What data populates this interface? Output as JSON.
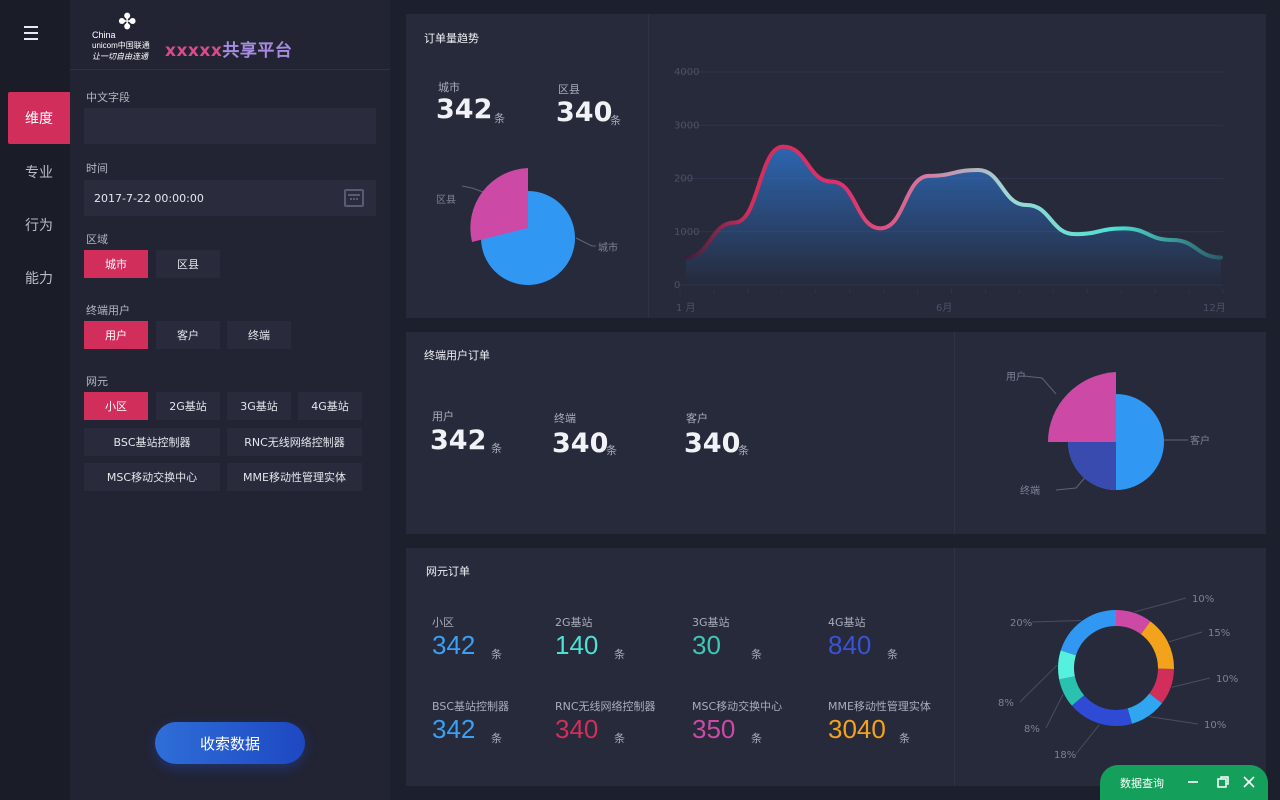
{
  "nav": {
    "items": [
      {
        "label": "维度",
        "active": true
      },
      {
        "label": "专业",
        "active": false
      },
      {
        "label": "行为",
        "active": false
      },
      {
        "label": "能力",
        "active": false
      }
    ]
  },
  "brand": {
    "logo_line1": "China",
    "logo_line2": "unicom中国联通",
    "logo_line3": "让一切自由连通",
    "title_a": "xxxxx",
    "title_b": "共享平台"
  },
  "filters": {
    "chinese_field_label": "中文字段",
    "chinese_field_value": "",
    "time_label": "时间",
    "time_value": "2017-7-22   00:00:00",
    "region_label": "区域",
    "region_options": [
      "城市",
      "区县"
    ],
    "terminal_label": "终端用户",
    "terminal_options": [
      "用户",
      "客户",
      "终端"
    ],
    "network_label": "网元",
    "network_options": [
      "小区",
      "2G基站",
      "3G基站",
      "4G基站",
      "BSC基站控制器",
      "RNC无线网络控制器",
      "MSC移动交换中心",
      "MME移动性管理实体"
    ],
    "search_button": "收索数据"
  },
  "order_trend": {
    "title": "订单量趋势",
    "stats": [
      {
        "label": "城市",
        "value": "342",
        "unit": "条"
      },
      {
        "label": "区县",
        "value": "340",
        "unit": "条"
      }
    ],
    "pie_labels": {
      "county": "区县",
      "city": "城市"
    },
    "pie_colors": {
      "county": "#cc4aa5",
      "city": "#3098f3"
    }
  },
  "chart_data": {
    "type": "area",
    "title": "",
    "y_ticks": [
      "4000",
      "3000",
      "200",
      "1000",
      "0"
    ],
    "x_ticks": [
      "1 月",
      "6月",
      "12月"
    ],
    "x": [
      1,
      2,
      3,
      4,
      5,
      6,
      7,
      8,
      9,
      10,
      11,
      12
    ],
    "values": [
      300,
      900,
      2200,
      1600,
      800,
      1700,
      1800,
      1200,
      700,
      800,
      600,
      300
    ],
    "grid": true,
    "legend": "none",
    "gradient": [
      "#d22e5b",
      "#5ee3d6"
    ]
  },
  "terminal_orders": {
    "title": "终端用户订单",
    "stats": [
      {
        "label": "用户",
        "value": "342",
        "unit": "条"
      },
      {
        "label": "终端",
        "value": "340",
        "unit": "条"
      },
      {
        "label": "客户",
        "value": "340",
        "unit": "条"
      }
    ],
    "pie_labels": {
      "user": "用户",
      "customer": "客户",
      "terminal": "终端"
    },
    "pie_colors": {
      "user": "#cc4aa5",
      "customer": "#3098f3",
      "terminal": "#3a4bb0"
    }
  },
  "network_orders": {
    "title": "网元订单",
    "stats": [
      {
        "label": "小区",
        "value": "342",
        "unit": "条",
        "color": "#3a9ff5"
      },
      {
        "label": "2G基站",
        "value": "140",
        "unit": "条",
        "color": "#4ee0d2"
      },
      {
        "label": "3G基站",
        "value": "30",
        "unit": "条",
        "color": "#3fc7b6"
      },
      {
        "label": "4G基站",
        "value": "840",
        "unit": "条",
        "color": "#3952d6"
      },
      {
        "label": "BSC基站控制器",
        "value": "342",
        "unit": "条",
        "color": "#3a9ff5"
      },
      {
        "label": "RNC无线网络控制器",
        "value": "340",
        "unit": "条",
        "color": "#d22e5b"
      },
      {
        "label": "MSC移动交换中心",
        "value": "350",
        "unit": "条",
        "color": "#cc4aa5"
      },
      {
        "label": "MME移动性管理实体",
        "value": "3040",
        "unit": "条",
        "color": "#f3a21c"
      }
    ],
    "donut": [
      {
        "pct": "10%",
        "color": "#cc4aa5"
      },
      {
        "pct": "15%",
        "color": "#f3a21c"
      },
      {
        "pct": "10%",
        "color": "#d22e5b"
      },
      {
        "pct": "10%",
        "color": "#2fa6ef"
      },
      {
        "pct": "18%",
        "color": "#2f4bd6"
      },
      {
        "pct": "8%",
        "color": "#28c2ae"
      },
      {
        "pct": "8%",
        "color": "#55f0de"
      },
      {
        "pct": "20%",
        "color": "#3098f3"
      }
    ]
  },
  "dock": {
    "label": "数据查询"
  }
}
